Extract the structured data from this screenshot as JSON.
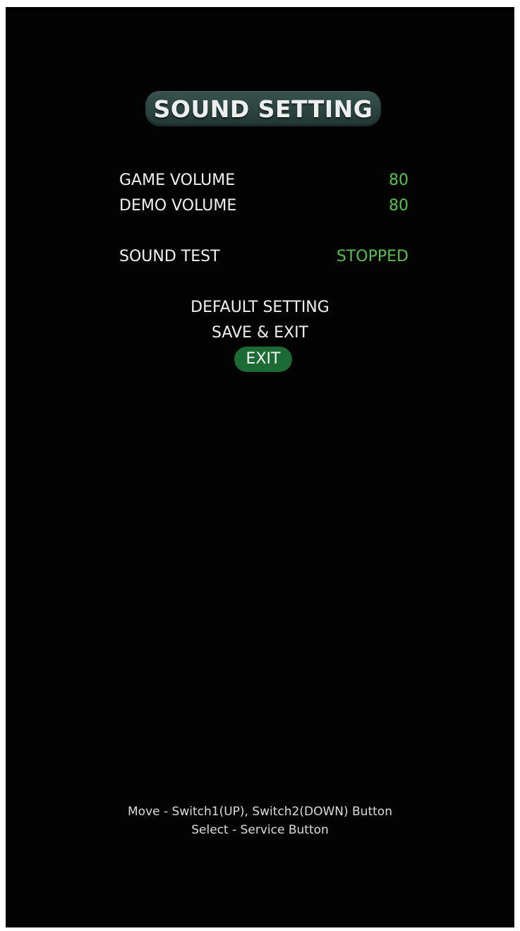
{
  "screen": {
    "title": "SOUND SETTING"
  },
  "settings": {
    "game_volume": {
      "label": "GAME VOLUME",
      "value": "80"
    },
    "demo_volume": {
      "label": "DEMO VOLUME",
      "value": "80"
    },
    "sound_test": {
      "label": "SOUND TEST",
      "value": "STOPPED"
    }
  },
  "menu": {
    "default_setting": "DEFAULT SETTING",
    "save_exit": "SAVE & EXIT",
    "exit": "EXIT"
  },
  "help": {
    "move": "Move - Switch1(UP), Switch2(DOWN) Button",
    "select": "Select - Service Button"
  },
  "colors": {
    "background": "#030303",
    "value_green": "#56c24b",
    "selection_green": "#1d6b34",
    "title_badge": "#2b4440"
  }
}
